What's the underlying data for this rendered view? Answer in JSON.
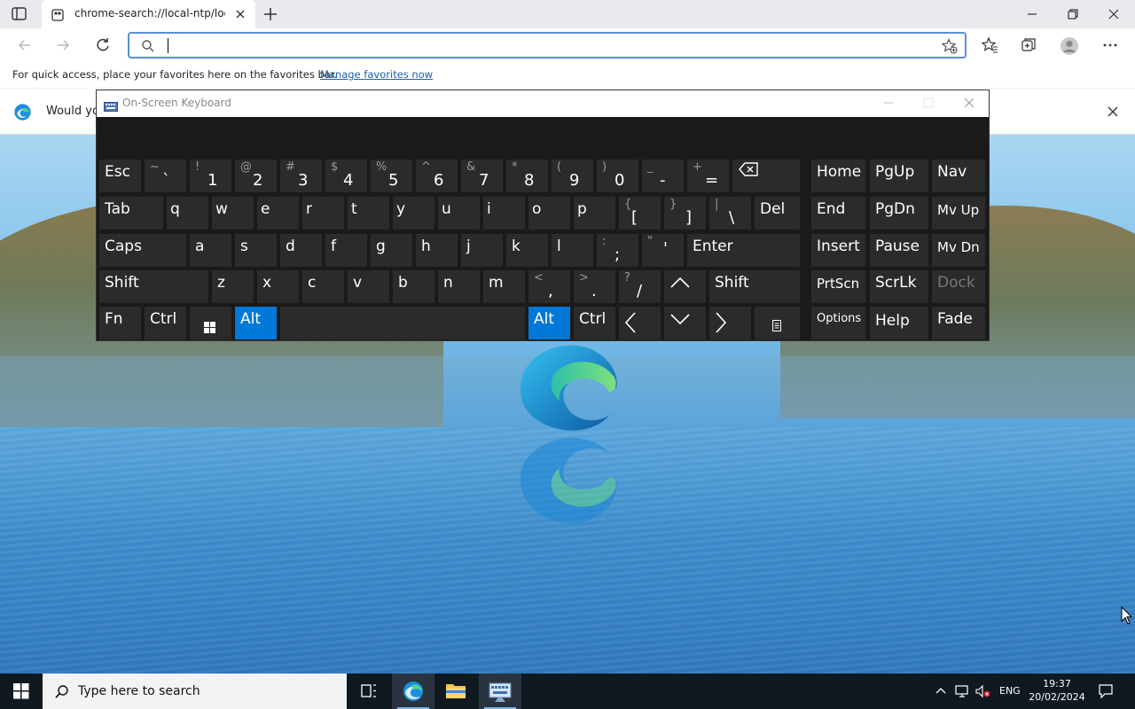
{
  "browser": {
    "tab_title": "chrome-search://local-ntp/local-ntp.html",
    "address_value": "",
    "address_placeholder": "",
    "favorites_bar_text": "For quick access, place your favorites here on the favorites bar.",
    "favorites_bar_link": "Manage favorites now",
    "infobar_text": "Would yo"
  },
  "osk": {
    "title": "On-Screen Keyboard",
    "rows": [
      [
        {
          "label": "Esc"
        },
        {
          "sym": "~",
          "main": "`"
        },
        {
          "sym": "!",
          "main": "1"
        },
        {
          "sym": "@",
          "main": "2"
        },
        {
          "sym": "#",
          "main": "3"
        },
        {
          "sym": "$",
          "main": "4"
        },
        {
          "sym": "%",
          "main": "5"
        },
        {
          "sym": "^",
          "main": "6"
        },
        {
          "sym": "&",
          "main": "7"
        },
        {
          "sym": "*",
          "main": "8"
        },
        {
          "sym": "(",
          "main": "9"
        },
        {
          "sym": ")",
          "main": "0"
        },
        {
          "sym": "_",
          "main": "-"
        },
        {
          "sym": "+",
          "main": "="
        },
        {
          "label": "⌫",
          "icon": "backspace-icon"
        },
        {
          "label": "Home"
        },
        {
          "label": "PgUp"
        },
        {
          "label": "Nav"
        }
      ],
      [
        {
          "label": "Tab"
        },
        {
          "label": "q"
        },
        {
          "label": "w"
        },
        {
          "label": "e"
        },
        {
          "label": "r"
        },
        {
          "label": "t"
        },
        {
          "label": "y"
        },
        {
          "label": "u"
        },
        {
          "label": "i"
        },
        {
          "label": "o"
        },
        {
          "label": "p"
        },
        {
          "sym": "{",
          "main": "["
        },
        {
          "sym": "}",
          "main": "]"
        },
        {
          "sym": "|",
          "main": "\\"
        },
        {
          "label": "Del"
        },
        {
          "label": "End"
        },
        {
          "label": "PgDn"
        },
        {
          "label": "Mv Up"
        }
      ],
      [
        {
          "label": "Caps"
        },
        {
          "label": "a"
        },
        {
          "label": "s"
        },
        {
          "label": "d"
        },
        {
          "label": "f"
        },
        {
          "label": "g"
        },
        {
          "label": "h"
        },
        {
          "label": "j"
        },
        {
          "label": "k"
        },
        {
          "label": "l"
        },
        {
          "sym": ":",
          "main": ";"
        },
        {
          "sym": "\"",
          "main": "'"
        },
        {
          "label": "Enter"
        },
        {
          "label": "Insert"
        },
        {
          "label": "Pause"
        },
        {
          "label": "Mv Dn"
        }
      ],
      [
        {
          "label": "Shift"
        },
        {
          "label": "z"
        },
        {
          "label": "x"
        },
        {
          "label": "c"
        },
        {
          "label": "v"
        },
        {
          "label": "b"
        },
        {
          "label": "n"
        },
        {
          "label": "m"
        },
        {
          "sym": "<",
          "main": ","
        },
        {
          "sym": ">",
          "main": "."
        },
        {
          "sym": "?",
          "main": "/"
        },
        {
          "label": "^",
          "icon": "arrow-up-icon"
        },
        {
          "label": "Shift"
        },
        {
          "label": "PrtScn"
        },
        {
          "label": "ScrLk"
        },
        {
          "label": "Dock",
          "dim": true
        }
      ],
      [
        {
          "label": "Fn"
        },
        {
          "label": "Ctrl"
        },
        {
          "label": "⊞",
          "icon": "windows-key-icon"
        },
        {
          "label": "Alt",
          "active": true
        },
        {
          "label": ""
        },
        {
          "label": "Alt",
          "active": true
        },
        {
          "label": "Ctrl"
        },
        {
          "label": "<",
          "icon": "arrow-left-icon"
        },
        {
          "label": "v",
          "icon": "arrow-down-icon"
        },
        {
          "label": ">",
          "icon": "arrow-right-icon"
        },
        {
          "label": "▤",
          "icon": "menu-key-icon"
        },
        {
          "label": "Options",
          "small": true
        },
        {
          "label": "Help"
        },
        {
          "label": "Fade"
        }
      ]
    ]
  },
  "taskbar": {
    "search_placeholder": "Type here to search",
    "language": "ENG",
    "time": "19:37",
    "date": "20/02/2024"
  },
  "colors": {
    "accent": "#0078d7",
    "key_bg": "#2b2b2b",
    "osk_bg": "#1a1a1a",
    "taskbar_bg": "#101820",
    "address_border": "#5a8fd8"
  }
}
